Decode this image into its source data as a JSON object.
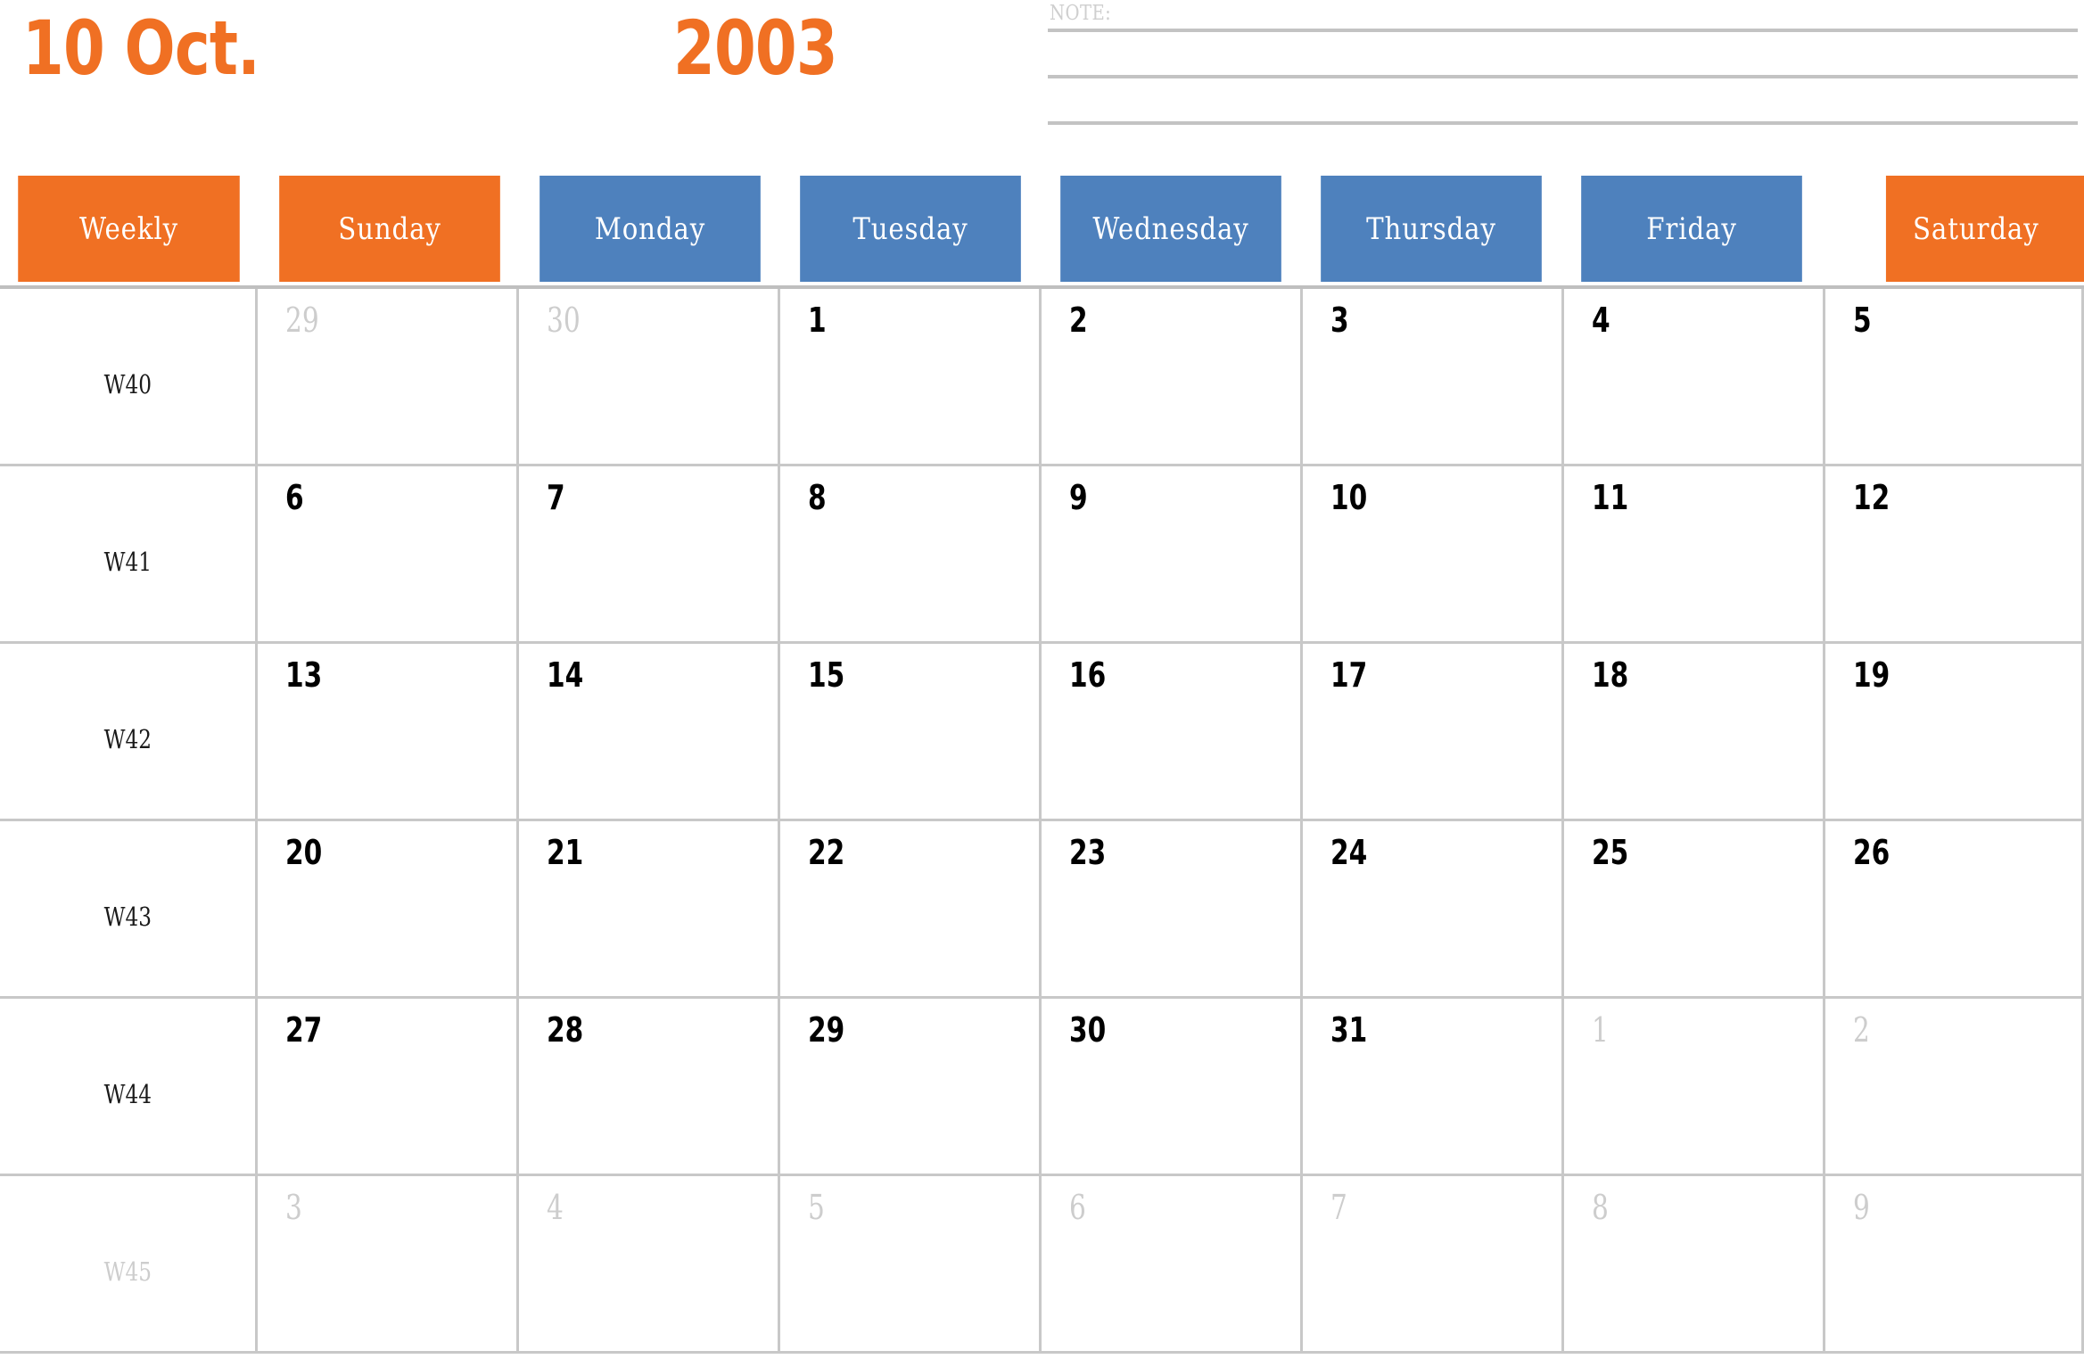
{
  "title": {
    "month": "10 Oct.",
    "year": "2003",
    "accent_color": "#f07023"
  },
  "note": {
    "label": "NOTE:",
    "line_color": "#c3c3c3",
    "lines": [
      "",
      "",
      ""
    ]
  },
  "colors": {
    "weekend_header_bg": "#f07023",
    "weekday_header_bg": "#4e81bd",
    "header_text": "#ffffff",
    "grid_line": "#c8c8c8",
    "in_month_text": "#000000",
    "out_month_text": "#cdcdcd"
  },
  "header": {
    "week_column_label": "Weekly",
    "days": [
      {
        "label": "Sunday",
        "type": "weekend"
      },
      {
        "label": "Monday",
        "type": "weekday"
      },
      {
        "label": "Tuesday",
        "type": "weekday"
      },
      {
        "label": "Wednesday",
        "type": "weekday"
      },
      {
        "label": "Thursday",
        "type": "weekday"
      },
      {
        "label": "Friday",
        "type": "weekday"
      },
      {
        "label": "Saturday",
        "type": "weekend"
      }
    ]
  },
  "weeks": [
    {
      "week_label": "W40",
      "week_label_out": false,
      "days": [
        {
          "n": "29",
          "out": true
        },
        {
          "n": "30",
          "out": true
        },
        {
          "n": "1",
          "out": false
        },
        {
          "n": "2",
          "out": false
        },
        {
          "n": "3",
          "out": false
        },
        {
          "n": "4",
          "out": false
        },
        {
          "n": "5",
          "out": false
        }
      ]
    },
    {
      "week_label": "W41",
      "week_label_out": false,
      "days": [
        {
          "n": "6",
          "out": false
        },
        {
          "n": "7",
          "out": false
        },
        {
          "n": "8",
          "out": false
        },
        {
          "n": "9",
          "out": false
        },
        {
          "n": "10",
          "out": false
        },
        {
          "n": "11",
          "out": false
        },
        {
          "n": "12",
          "out": false
        }
      ]
    },
    {
      "week_label": "W42",
      "week_label_out": false,
      "days": [
        {
          "n": "13",
          "out": false
        },
        {
          "n": "14",
          "out": false
        },
        {
          "n": "15",
          "out": false
        },
        {
          "n": "16",
          "out": false
        },
        {
          "n": "17",
          "out": false
        },
        {
          "n": "18",
          "out": false
        },
        {
          "n": "19",
          "out": false
        }
      ]
    },
    {
      "week_label": "W43",
      "week_label_out": false,
      "days": [
        {
          "n": "20",
          "out": false
        },
        {
          "n": "21",
          "out": false
        },
        {
          "n": "22",
          "out": false
        },
        {
          "n": "23",
          "out": false
        },
        {
          "n": "24",
          "out": false
        },
        {
          "n": "25",
          "out": false
        },
        {
          "n": "26",
          "out": false
        }
      ]
    },
    {
      "week_label": "W44",
      "week_label_out": false,
      "days": [
        {
          "n": "27",
          "out": false
        },
        {
          "n": "28",
          "out": false
        },
        {
          "n": "29",
          "out": false
        },
        {
          "n": "30",
          "out": false
        },
        {
          "n": "31",
          "out": false
        },
        {
          "n": "1",
          "out": true
        },
        {
          "n": "2",
          "out": true
        }
      ]
    },
    {
      "week_label": "W45",
      "week_label_out": true,
      "days": [
        {
          "n": "3",
          "out": true
        },
        {
          "n": "4",
          "out": true
        },
        {
          "n": "5",
          "out": true
        },
        {
          "n": "6",
          "out": true
        },
        {
          "n": "7",
          "out": true
        },
        {
          "n": "8",
          "out": true
        },
        {
          "n": "9",
          "out": true
        }
      ]
    }
  ]
}
